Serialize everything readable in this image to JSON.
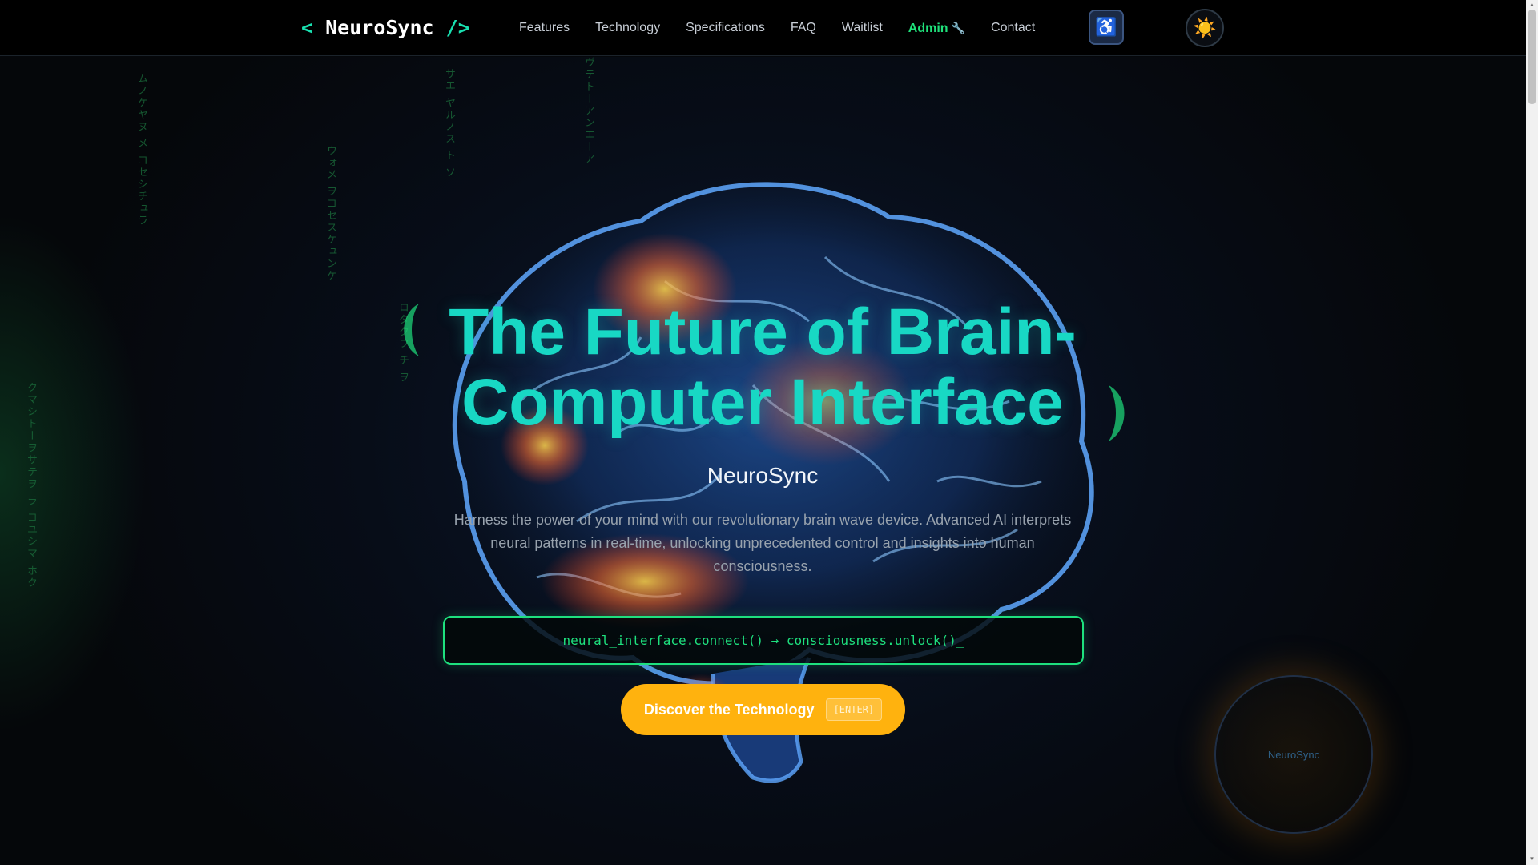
{
  "header": {
    "logo": {
      "open": "<",
      "name": "NeuroSync",
      "close": "/>"
    },
    "nav": [
      {
        "label": "Features"
      },
      {
        "label": "Technology"
      },
      {
        "label": "Specifications"
      },
      {
        "label": "FAQ"
      },
      {
        "label": "Waitlist"
      },
      {
        "label": "Admin",
        "icon": "wrench-icon",
        "glyph": "🔧",
        "accent": "#1fe07a"
      },
      {
        "label": "Contact"
      }
    ],
    "accessibility_button": {
      "icon": "accessibility-icon",
      "glyph": "♿"
    },
    "theme_toggle": {
      "icon": "sun-icon",
      "glyph": "☀️"
    }
  },
  "hero": {
    "title": "The Future of Brain-Computer Interface",
    "brand": "NeuroSync",
    "description": "Harness the power of your mind with our revolutionary brain wave device. Advanced AI interprets neural patterns in real-time, unlocking unprecedented control and insights into human consciousness.",
    "code": "neural_interface.connect() → consciousness.unlock()_",
    "cta": {
      "label": "Discover the Technology",
      "kbd": "[ENTER]"
    },
    "orb_label": "NeuroSync",
    "matrix_columns": [
      "ムノケヤヌ メ コセシチュラ",
      "サエ ヤルノス ト ソ",
      "ヴテトーアンエーア",
      "ウォメ ヲヨセスケュンケ",
      "ロタクフ チ ヲ",
      "クマシトーヲサテヲ ラ ヨユシマ ホク"
    ]
  },
  "colors": {
    "accent_teal": "#18d8c4",
    "accent_green": "#1ee07e",
    "cta_orange": "#ffb20e",
    "background": "#05070a"
  }
}
